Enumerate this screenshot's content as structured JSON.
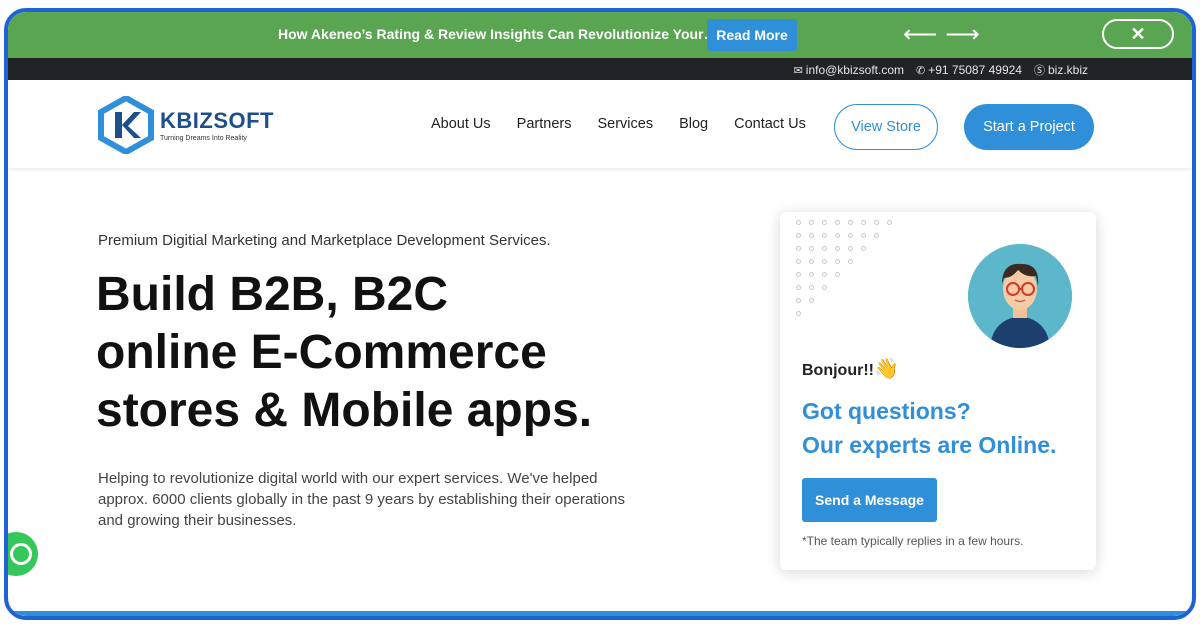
{
  "promo": {
    "text": "How Akeneo’s Rating & Review Insights Can Revolutionize Your…",
    "read_more": "Read More",
    "arrows": "⟵ ⟶",
    "close": "✕",
    "color": "#5aa552"
  },
  "contact": {
    "email": "info@kbizsoft.com",
    "phone": "+91 75087 49924",
    "skype": "biz.kbiz"
  },
  "header": {
    "logo_name": "KBIZSOFT",
    "logo_tagline": "Turning Dreams Into Reality",
    "nav": [
      "About Us",
      "Partners",
      "Services",
      "Blog",
      "Contact Us"
    ],
    "view_store": "View Store",
    "start_project": "Start a Project"
  },
  "hero": {
    "subtitle": "Premium Digitial Marketing and Marketplace Development Services.",
    "title_lines": [
      "Build B2B, B2C",
      "online E-Commerce",
      "stores & Mobile apps."
    ],
    "description": "Helping to revolutionize digital world with our expert services. We've helped approx. 6000 clients globally in the past 9 years by establishing their operations and growing their businesses."
  },
  "chat": {
    "greeting": "Bonjour!!",
    "wave_emoji": "👋",
    "question_line1": "Got questions?",
    "question_line2": "Our experts are Online.",
    "send_button": "Send a Message",
    "reply_note": "*The team typically replies in a few hours."
  },
  "colors": {
    "accent": "#2f8fd8",
    "brand_dark": "#1d4f8c",
    "frame": "#1e63d6",
    "contact_bar": "#222326",
    "whatsapp": "#34c759"
  }
}
